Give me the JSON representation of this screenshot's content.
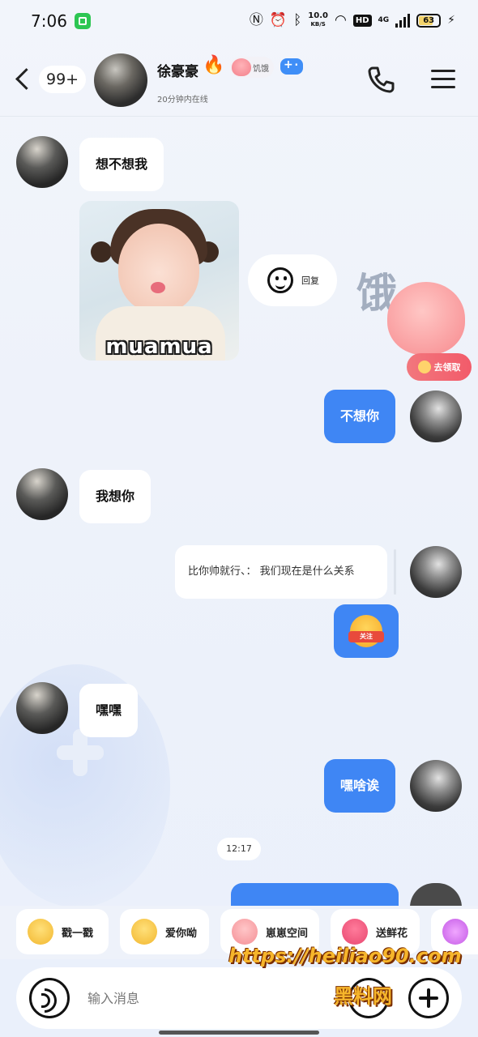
{
  "status_bar": {
    "time": "7:06",
    "net_speed_value": "10.0",
    "net_speed_unit": "KB/S",
    "hd_badge": "HD",
    "network_type": "4G",
    "battery_percent": "63"
  },
  "header": {
    "unread_count": "99+",
    "contact_name": "徐豪豪",
    "fire_level": "9",
    "peach_badge_label": "饥饿",
    "online_status": "20分钟内在线"
  },
  "messages": [
    {
      "from": "contact",
      "type": "text",
      "text": "想不想我"
    },
    {
      "from": "contact",
      "type": "sticker",
      "caption": "muamua"
    },
    {
      "from": "me",
      "type": "text",
      "text": "不想你"
    },
    {
      "from": "contact",
      "type": "text",
      "text": "我想你"
    },
    {
      "from": "me",
      "type": "quote",
      "text": "比你帅就行、：  我们现在是什么关系"
    },
    {
      "from": "me",
      "type": "emoji",
      "tag": "关注"
    },
    {
      "from": "contact",
      "type": "text",
      "text": "嘿嘿"
    },
    {
      "from": "me",
      "type": "text",
      "text": "嘿啥诶"
    }
  ],
  "quick_reply": {
    "label": "回复"
  },
  "mascot": {
    "deco_text": "饿",
    "cta_label": "去领取"
  },
  "timestamp": "12:17",
  "quick_actions": [
    {
      "label": "戳一戳",
      "icon": "poke-emoji-icon",
      "color": "#f7d04a"
    },
    {
      "label": "爱你呦",
      "icon": "heart-eyes-emoji-icon",
      "color": "#f7c548"
    },
    {
      "label": "崽崽空间",
      "icon": "peach-mascot-icon",
      "color": "#f7a4a8"
    },
    {
      "label": "送鲜花",
      "icon": "flower-icon",
      "color": "#e8476f"
    },
    {
      "label": "",
      "icon": "fire-icon",
      "color": "#d66ef2"
    }
  ],
  "input": {
    "placeholder": "输入消息"
  },
  "watermark": {
    "url": "https://heiliao90.com",
    "name": "黑料网"
  },
  "colors": {
    "outgoing_bubble": "#3f86f4",
    "incoming_bubble": "#ffffff",
    "background": "#eef2fa"
  }
}
